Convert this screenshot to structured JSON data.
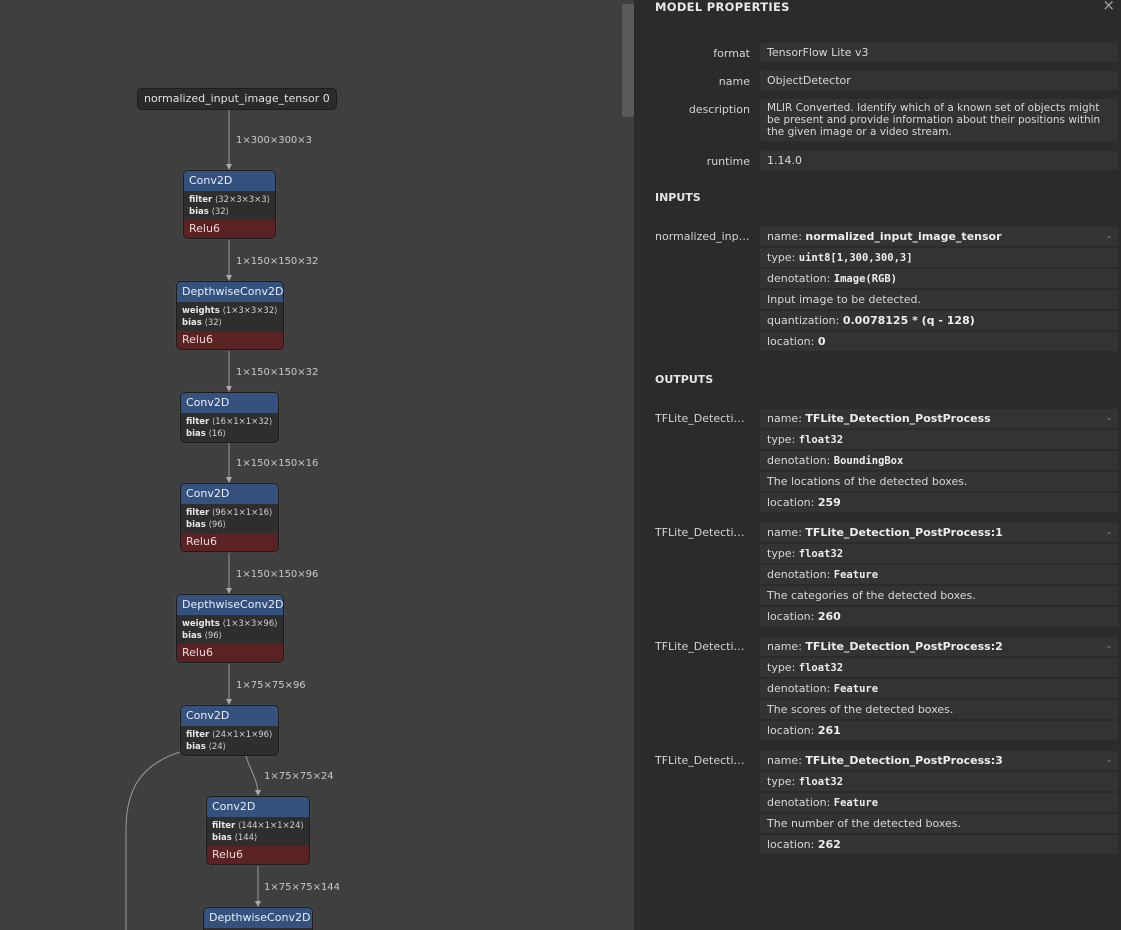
{
  "graph": {
    "input_node": "normalized_input_image_tensor 0",
    "edge_labels": [
      "1×300×300×3",
      "1×150×150×32",
      "1×150×150×32",
      "1×150×150×16",
      "1×150×150×96",
      "1×75×75×96",
      "1×75×75×24",
      "1×75×75×144"
    ],
    "nodes": [
      {
        "title": "Conv2D",
        "a1k": "filter",
        "a1v": "⟨32×3×3×3⟩",
        "a2k": "bias",
        "a2v": "⟨32⟩",
        "act": "Relu6"
      },
      {
        "title": "DepthwiseConv2D",
        "a1k": "weights",
        "a1v": "⟨1×3×3×32⟩",
        "a2k": "bias",
        "a2v": "⟨32⟩",
        "act": "Relu6"
      },
      {
        "title": "Conv2D",
        "a1k": "filter",
        "a1v": "⟨16×1×1×32⟩",
        "a2k": "bias",
        "a2v": "⟨16⟩",
        "act": ""
      },
      {
        "title": "Conv2D",
        "a1k": "filter",
        "a1v": "⟨96×1×1×16⟩",
        "a2k": "bias",
        "a2v": "⟨96⟩",
        "act": "Relu6"
      },
      {
        "title": "DepthwiseConv2D",
        "a1k": "weights",
        "a1v": "⟨1×3×3×96⟩",
        "a2k": "bias",
        "a2v": "⟨96⟩",
        "act": "Relu6"
      },
      {
        "title": "Conv2D",
        "a1k": "filter",
        "a1v": "⟨24×1×1×96⟩",
        "a2k": "bias",
        "a2v": "⟨24⟩",
        "act": ""
      },
      {
        "title": "Conv2D",
        "a1k": "filter",
        "a1v": "⟨144×1×1×24⟩",
        "a2k": "bias",
        "a2v": "⟨144⟩",
        "act": "Relu6"
      },
      {
        "title": "DepthwiseConv2D"
      }
    ]
  },
  "sidebar": {
    "title": "MODEL PROPERTIES",
    "close": "×",
    "props": [
      {
        "label": "format",
        "value": "TensorFlow Lite v3"
      },
      {
        "label": "name",
        "value": "ObjectDetector"
      },
      {
        "label": "description",
        "value": "MLIR Converted. Identify which of a known set of objects might be present and provide information about their positions within the given image or a video stream."
      },
      {
        "label": "runtime",
        "value": "1.14.0"
      }
    ],
    "inputs_title": "INPUTS",
    "outputs_title": "OUTPUTS",
    "inputs": [
      {
        "label": "normalized_inpu…",
        "name_k": "name: ",
        "name": "normalized_input_image_tensor",
        "type_k": "type: ",
        "type": "uint8[1,300,300,3]",
        "den_k": "denotation: ",
        "den": "Image(RGB)",
        "desc": "Input image to be detected.",
        "q_k": "quantization: ",
        "q": "0.0078125 * (q - 128)",
        "loc_k": "location: ",
        "loc": "0",
        "toggle": "-"
      }
    ],
    "outputs": [
      {
        "label": "TFLite_Detectio…",
        "name_k": "name: ",
        "name": "TFLite_Detection_PostProcess",
        "type_k": "type: ",
        "type": "float32",
        "den_k": "denotation: ",
        "den": "BoundingBox",
        "desc": "The locations of the detected boxes.",
        "loc_k": "location: ",
        "loc": "259",
        "toggle": "-"
      },
      {
        "label": "TFLite_Detectio…",
        "name_k": "name: ",
        "name": "TFLite_Detection_PostProcess:1",
        "type_k": "type: ",
        "type": "float32",
        "den_k": "denotation: ",
        "den": "Feature",
        "desc": "The categories of the detected boxes.",
        "loc_k": "location: ",
        "loc": "260",
        "toggle": "-"
      },
      {
        "label": "TFLite_Detectio…",
        "name_k": "name: ",
        "name": "TFLite_Detection_PostProcess:2",
        "type_k": "type: ",
        "type": "float32",
        "den_k": "denotation: ",
        "den": "Feature",
        "desc": "The scores of the detected boxes.",
        "loc_k": "location: ",
        "loc": "261",
        "toggle": "-"
      },
      {
        "label": "TFLite_Detectio…",
        "name_k": "name: ",
        "name": "TFLite_Detection_PostProcess:3",
        "type_k": "type: ",
        "type": "float32",
        "den_k": "denotation: ",
        "den": "Feature",
        "desc": "The number of the detected boxes.",
        "loc_k": "location: ",
        "loc": "262",
        "toggle": "-"
      }
    ]
  }
}
